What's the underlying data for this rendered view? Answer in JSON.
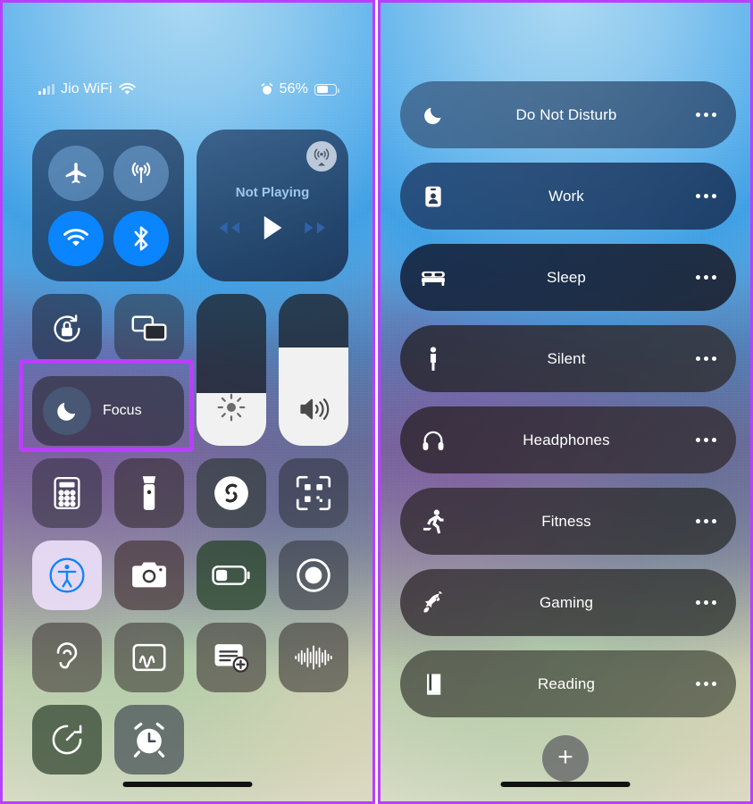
{
  "left_panel": {
    "status_bar": {
      "carrier": "Jio WiFi",
      "signal_icon": "cellular-bars-icon",
      "wifi_icon": "wifi-icon",
      "alarm_icon": "alarm-clock-icon",
      "battery_percent": "56%",
      "battery_icon": "battery-icon"
    },
    "connectivity": {
      "airplane": {
        "label": "Airplane Mode",
        "icon": "airplane-icon",
        "state": "off"
      },
      "cellular": {
        "label": "Cellular Data",
        "icon": "cellular-antenna-icon",
        "state": "off"
      },
      "wifi": {
        "label": "Wi-Fi",
        "icon": "wifi-icon",
        "state": "on"
      },
      "bluetooth": {
        "label": "Bluetooth",
        "icon": "bluetooth-icon",
        "state": "on"
      }
    },
    "media": {
      "now_playing": "Not Playing",
      "airplay_icon": "airplay-audio-icon",
      "rewind_icon": "rewind-icon",
      "play_icon": "play-icon",
      "forward_icon": "fast-forward-icon"
    },
    "rotation_lock": {
      "label": "Rotation Lock",
      "icon": "rotation-lock-icon"
    },
    "screen_mirroring": {
      "label": "Screen Mirroring",
      "icon": "screen-mirroring-icon"
    },
    "focus": {
      "label": "Focus",
      "icon": "moon-icon"
    },
    "brightness": {
      "label": "Brightness",
      "icon": "brightness-icon",
      "value": 35
    },
    "volume": {
      "label": "Volume",
      "icon": "speaker-icon",
      "value": 65
    },
    "apps": [
      {
        "label": "Calculator",
        "icon": "calculator-icon",
        "tint": "dark"
      },
      {
        "label": "Flashlight",
        "icon": "flashlight-icon",
        "tint": "dark"
      },
      {
        "label": "Shazam",
        "icon": "shazam-icon",
        "tint": "dark-green"
      },
      {
        "label": "Code Scanner",
        "icon": "qr-scanner-icon",
        "tint": "dark"
      },
      {
        "label": "Accessibility Shortcuts",
        "icon": "accessibility-icon",
        "tint": "light"
      },
      {
        "label": "Camera",
        "icon": "camera-icon",
        "tint": "dark-maroon"
      },
      {
        "label": "Low Power Mode",
        "icon": "low-battery-icon",
        "tint": "green"
      },
      {
        "label": "Screen Recording",
        "icon": "screen-record-icon",
        "tint": "dark"
      },
      {
        "label": "Hearing",
        "icon": "ear-icon",
        "tint": "dark"
      },
      {
        "label": "Music Recognition",
        "icon": "music-note-chart-icon",
        "tint": "dark"
      },
      {
        "label": "Quick Note",
        "icon": "quick-note-icon",
        "tint": "dark"
      },
      {
        "label": "Voice Memos",
        "icon": "waveform-icon",
        "tint": "dark"
      },
      {
        "label": "Timer",
        "icon": "timer-icon",
        "tint": "green"
      },
      {
        "label": "Alarm",
        "icon": "alarm-clock-icon",
        "tint": "dark-blue"
      }
    ]
  },
  "right_panel": {
    "focus_modes": [
      {
        "label": "Do Not Disturb",
        "icon": "moon-icon"
      },
      {
        "label": "Work",
        "icon": "id-badge-icon"
      },
      {
        "label": "Sleep",
        "icon": "bed-icon"
      },
      {
        "label": "Silent",
        "icon": "person-standing-icon"
      },
      {
        "label": "Headphones",
        "icon": "headphones-icon"
      },
      {
        "label": "Fitness",
        "icon": "running-person-icon"
      },
      {
        "label": "Gaming",
        "icon": "rocket-icon"
      },
      {
        "label": "Reading",
        "icon": "book-icon"
      }
    ],
    "options_icon": "ellipsis-icon",
    "add_button": {
      "label": "+",
      "icon": "plus-icon"
    }
  },
  "annotations": {
    "highlight_color": "#b93fff",
    "focus_highlight_target": "Focus",
    "silent_highlight_target": "Silent"
  }
}
